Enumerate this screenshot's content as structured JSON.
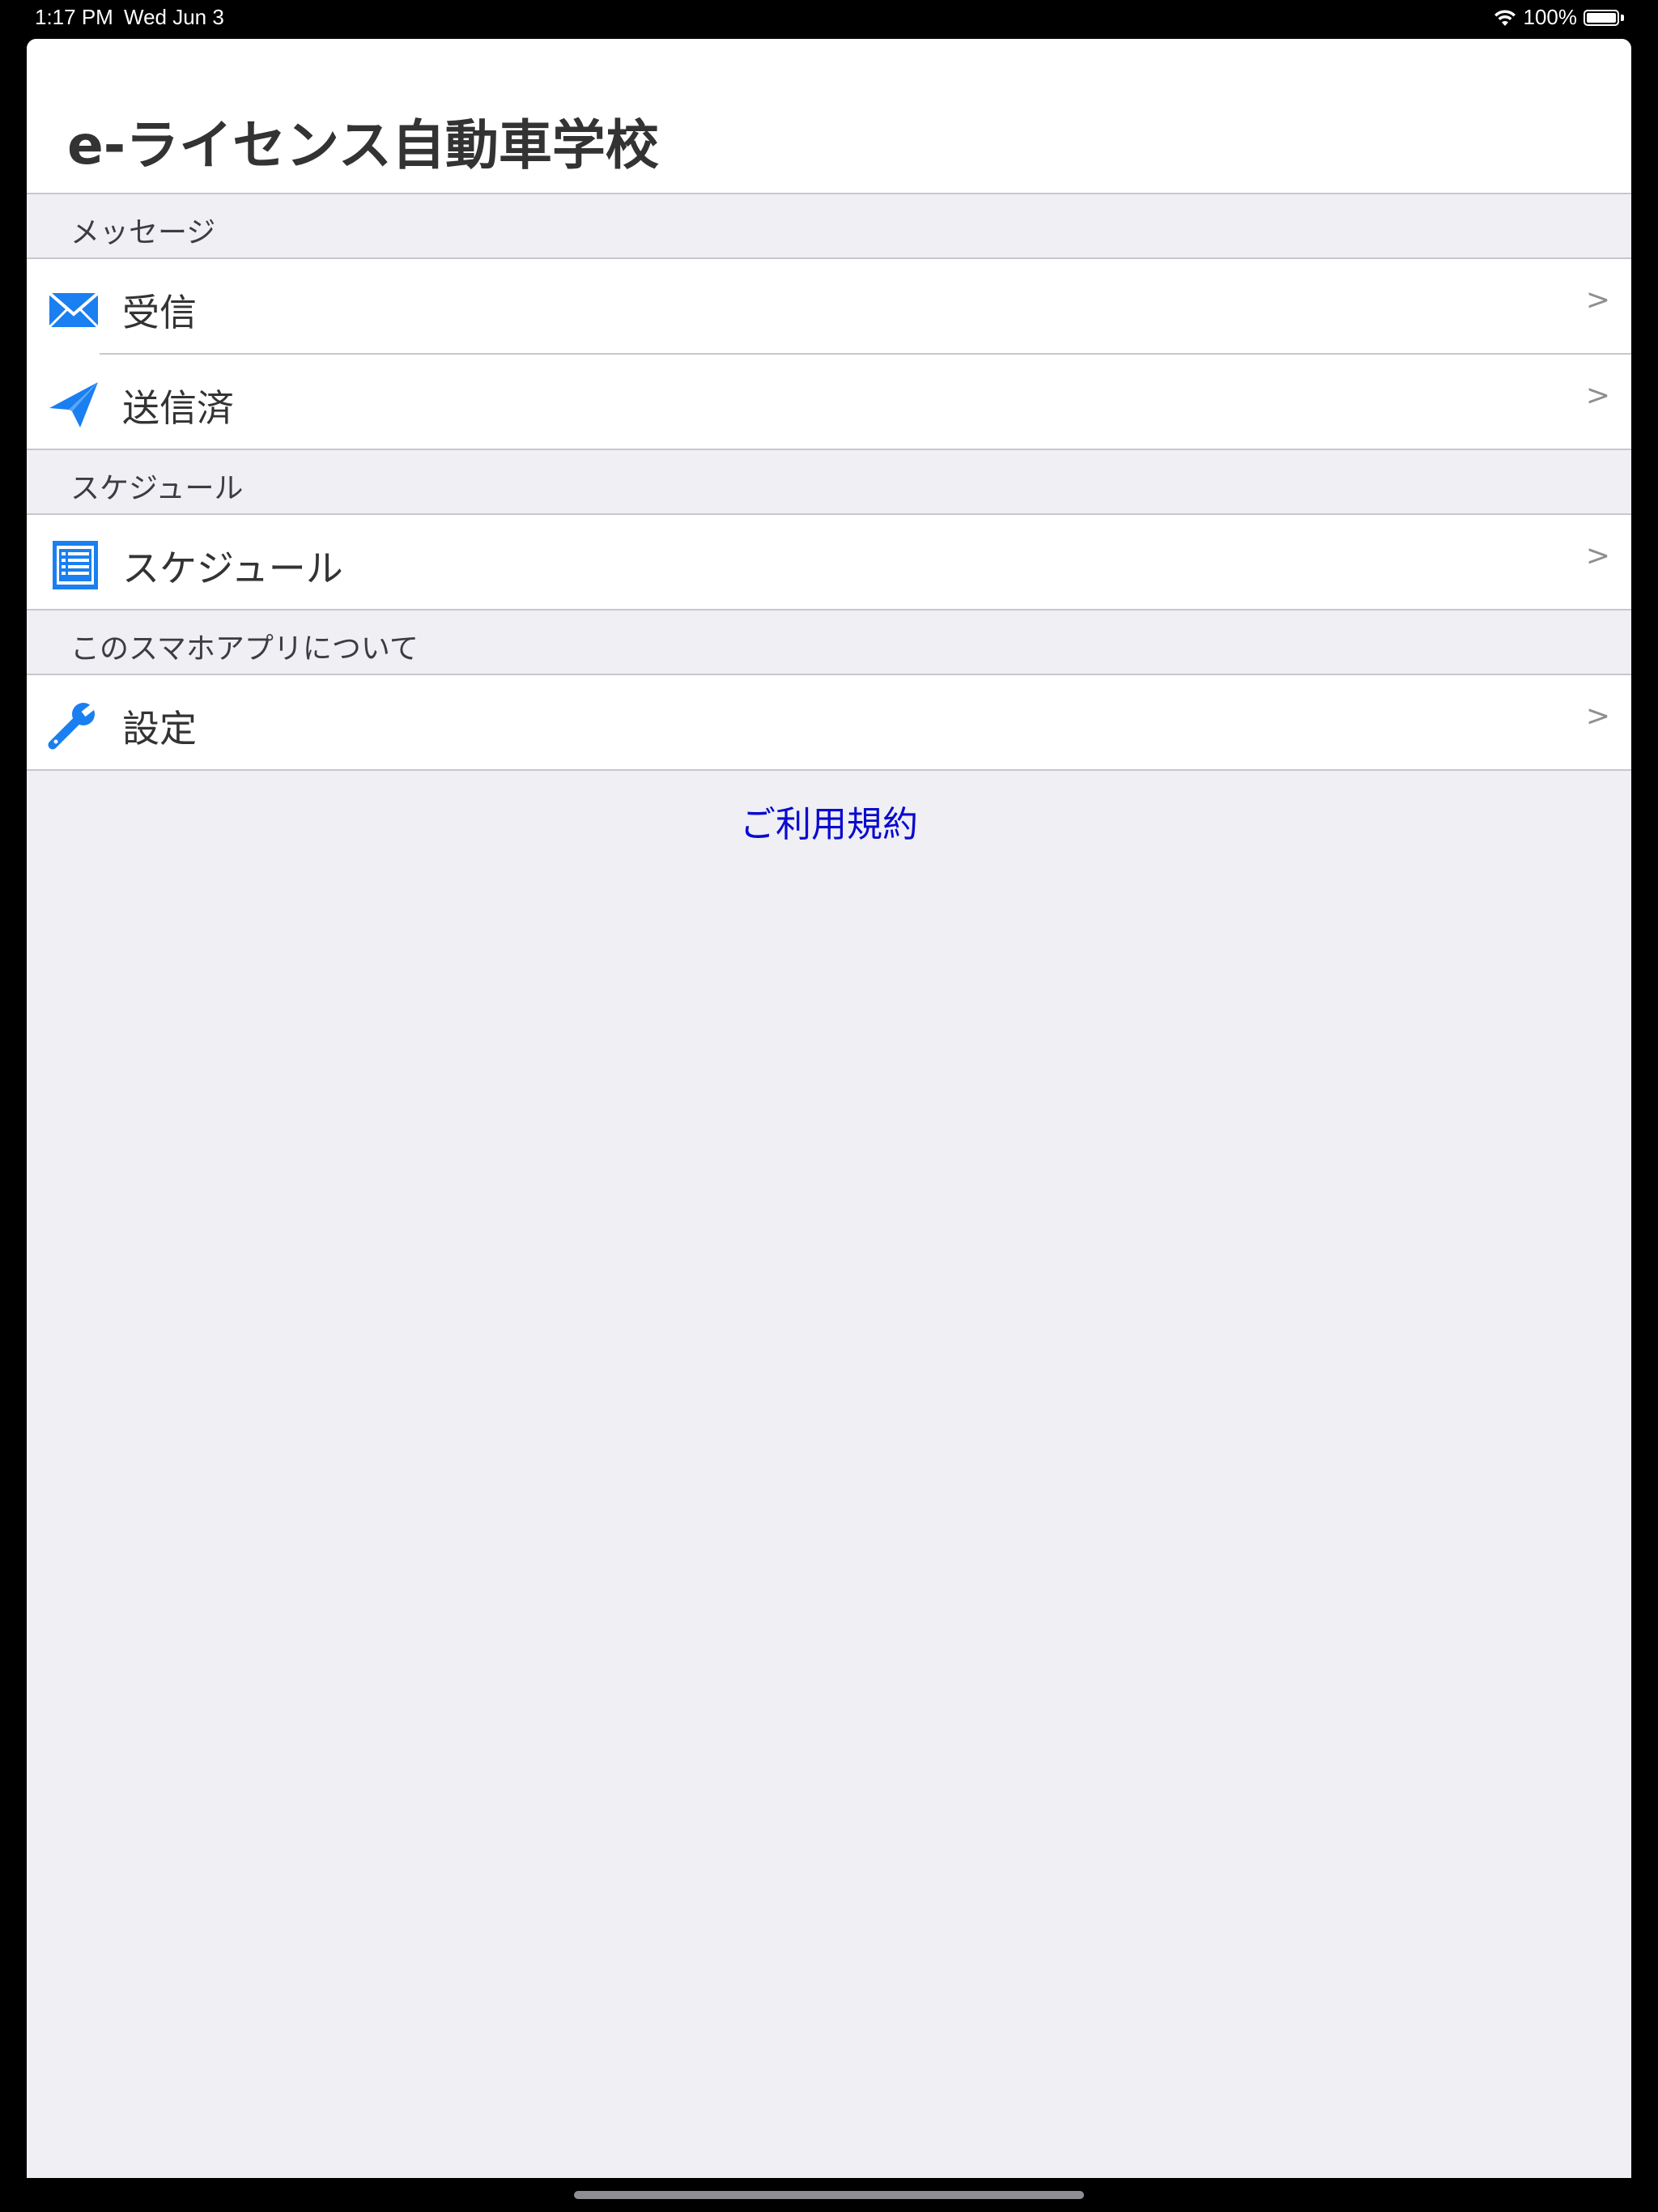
{
  "status": {
    "time": "1:17 PM",
    "date": "Wed Jun 3",
    "battery": "100%"
  },
  "header": {
    "title": "e-ライセンス自動車学校"
  },
  "sections": {
    "messages": {
      "header": "メッセージ",
      "inbox_label": "受信",
      "sent_label": "送信済"
    },
    "schedule": {
      "header": "スケジュール",
      "schedule_label": "スケジュール"
    },
    "about": {
      "header": "このスマホアプリについて",
      "settings_label": "設定"
    }
  },
  "chevron": ">",
  "footer": {
    "terms_label": "ご利用規約"
  },
  "colors": {
    "icon_blue": "#1a7ff0",
    "link": "#0a0ad0",
    "background": "#efeff4"
  },
  "icons": {
    "inbox": "envelope-icon",
    "sent": "paper-plane-icon",
    "schedule": "list-icon",
    "settings": "wrench-icon"
  }
}
